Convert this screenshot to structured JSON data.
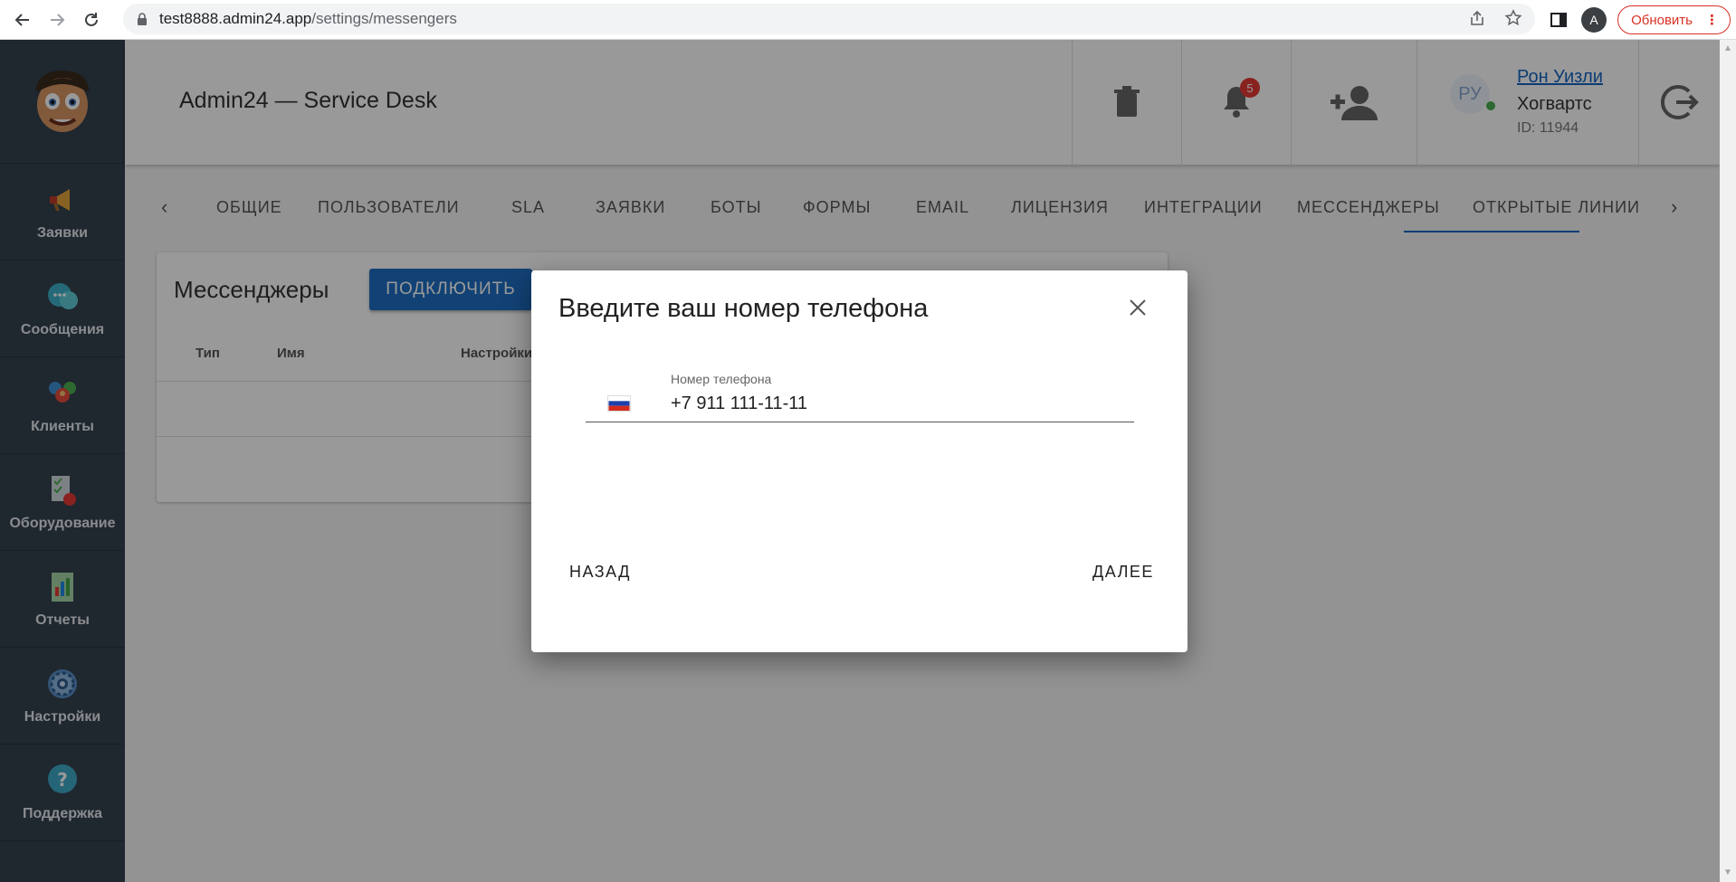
{
  "browser": {
    "url_host": "test8888.admin24.app",
    "url_path": "/settings/messengers",
    "profile_initial": "A",
    "update_label": "Обновить"
  },
  "sidebar": {
    "items": [
      {
        "label": "Заявки",
        "icon": "megaphone-icon"
      },
      {
        "label": "Сообщения",
        "icon": "chat-bubbles-icon"
      },
      {
        "label": "Клиенты",
        "icon": "clients-icon"
      },
      {
        "label": "Оборудование",
        "icon": "equipment-icon"
      },
      {
        "label": "Отчеты",
        "icon": "reports-icon"
      },
      {
        "label": "Настройки",
        "icon": "settings-gear-icon"
      },
      {
        "label": "Поддержка",
        "icon": "help-bubble-icon"
      }
    ]
  },
  "header": {
    "title": "Admin24 — Service Desk",
    "notifications_count": "5",
    "user": {
      "avatar_initials": "РУ",
      "name": "Рон Уизли",
      "org": "Хогвартс",
      "id": "ID: 11944"
    }
  },
  "tabs": [
    {
      "label": "ОБЩИЕ"
    },
    {
      "label": "ПОЛЬЗОВАТЕЛИ"
    },
    {
      "label": "SLA"
    },
    {
      "label": "ЗАЯВКИ"
    },
    {
      "label": "БОТЫ"
    },
    {
      "label": "ФОРМЫ"
    },
    {
      "label": "EMAIL"
    },
    {
      "label": "ЛИЦЕНЗИЯ"
    },
    {
      "label": "ИНТЕГРАЦИИ"
    },
    {
      "label": "МЕССЕНДЖЕРЫ",
      "active": true
    },
    {
      "label": "ОТКРЫТЫЕ ЛИНИИ"
    }
  ],
  "card": {
    "title": "Мессенджеры",
    "connect_label": "ПОДКЛЮЧИТЬ",
    "columns": [
      "Тип",
      "Имя",
      "Настройки"
    ]
  },
  "modal": {
    "title": "Введите ваш номер телефона",
    "field_label": "Номер телефона",
    "field_value": "+7 911 111-11-11",
    "back_label": "НАЗАД",
    "next_label": "ДАЛЕЕ"
  },
  "colors": {
    "sidebar": "#34414f",
    "accent": "#1e6fc4",
    "badge": "#e53935"
  }
}
